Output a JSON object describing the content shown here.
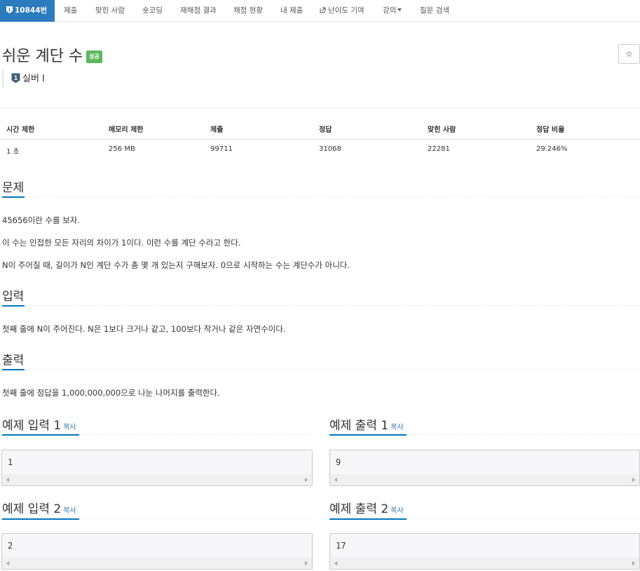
{
  "nav": {
    "problem_number": "10844번",
    "items": [
      {
        "label": "제출"
      },
      {
        "label": "맞힌 사람"
      },
      {
        "label": "숏코딩"
      },
      {
        "label": "재채점 결과"
      },
      {
        "label": "채점 현황"
      },
      {
        "label": "내 제출"
      },
      {
        "label": "난이도 기여"
      },
      {
        "label": "강의"
      },
      {
        "label": "질문 검색"
      }
    ]
  },
  "problem": {
    "title": "쉬운 계단 수",
    "status_badge": "성공",
    "star": "☆",
    "tier": "실버 I"
  },
  "table": {
    "headers": [
      "시간 제한",
      "메모리 제한",
      "제출",
      "정답",
      "맞힌 사람",
      "정답 비율"
    ],
    "values": [
      "1 초",
      "256 MB",
      "99711",
      "31068",
      "22281",
      "29.246%"
    ]
  },
  "sections": {
    "problem": {
      "heading": "문제",
      "lines": [
        "45656이란 수를 보자.",
        "이 수는 인접한 모든 자리의 차이가 1이다. 이런 수를 계단 수라고 한다.",
        "N이 주어질 때, 길이가 N인 계단 수가 총 몇 개 있는지 구해보자. 0으로 시작하는 수는 계단수가 아니다."
      ]
    },
    "input": {
      "heading": "입력",
      "text": "첫째 줄에 N이 주어진다. N은 1보다 크거나 같고, 100보다 작거나 같은 자연수이다."
    },
    "output": {
      "heading": "출력",
      "text": "첫째 줄에 정답을 1,000,000,000으로 나눈 나머지를 출력한다."
    }
  },
  "samples": {
    "copy_label": "복사",
    "input1": {
      "heading": "예제 입력 1",
      "value": "1"
    },
    "output1": {
      "heading": "예제 출력 1",
      "value": "9"
    },
    "input2": {
      "heading": "예제 입력 2",
      "value": "2"
    },
    "output2": {
      "heading": "예제 출력 2",
      "value": "17"
    }
  },
  "colors": {
    "nav_active": "#2b7bbf",
    "success_badge": "#5cb85c",
    "headline_underline": "#0076c0",
    "link": "#337ab7"
  }
}
